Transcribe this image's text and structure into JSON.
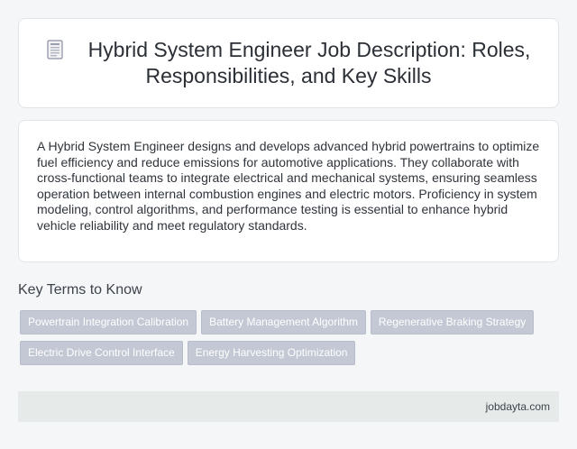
{
  "header": {
    "icon": "document-icon",
    "title": "Hybrid System Engineer Job Description: Roles, Responsibilities, and Key Skills"
  },
  "description": {
    "text": "A Hybrid System Engineer designs and develops advanced hybrid powertrains to optimize fuel efficiency and reduce emissions for automotive applications. They collaborate with cross-functional teams to integrate electrical and mechanical systems, ensuring seamless operation between internal combustion engines and electric motors. Proficiency in system modeling, control algorithms, and performance testing is essential to enhance hybrid vehicle reliability and meet regulatory standards."
  },
  "key_terms": {
    "heading": "Key Terms to Know",
    "tags": [
      "Powertrain Integration Calibration",
      "Battery Management Algorithm",
      "Regenerative Braking Strategy",
      "Electric Drive Control Interface",
      "Energy Harvesting Optimization"
    ]
  },
  "footer": {
    "source": "jobdayta.com"
  },
  "colors": {
    "background": "#f5f6f8",
    "card": "#ffffff",
    "tag": "#c3c8d4",
    "footer": "#e6ebea"
  }
}
